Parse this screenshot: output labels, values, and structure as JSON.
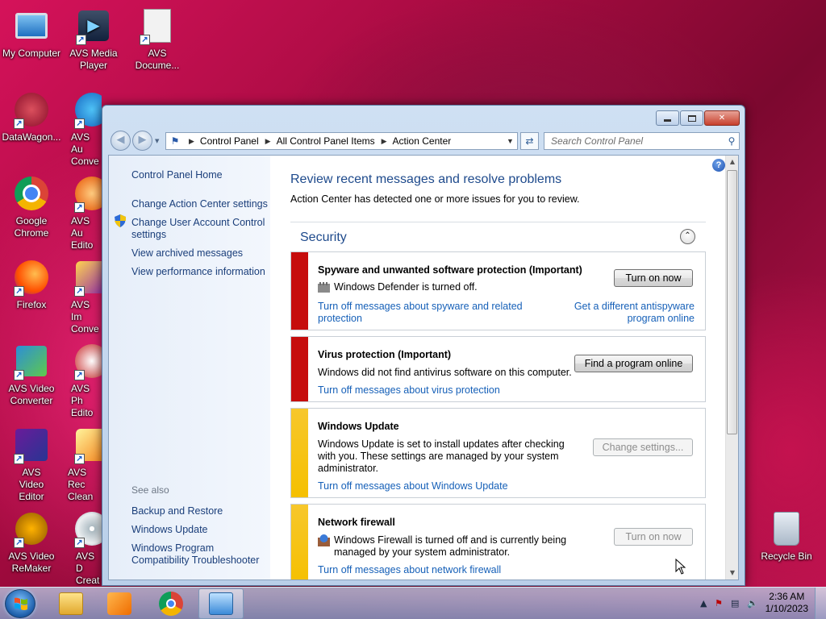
{
  "desktop": {
    "icons": [
      {
        "label": "My Computer",
        "icon": "computer-icon"
      },
      {
        "label": "AVS Media Player",
        "icon": "media-player-icon"
      },
      {
        "label": "AVS Docume...",
        "icon": "document-converter-icon"
      },
      {
        "label": "DataWagon...",
        "icon": "datawagon-icon"
      },
      {
        "label": "AVS Au Conve",
        "icon": "audio-converter-icon"
      },
      {
        "label": "Google Chrome",
        "icon": "chrome-icon"
      },
      {
        "label": "AVS Au Edito",
        "icon": "audio-editor-icon"
      },
      {
        "label": "Firefox",
        "icon": "firefox-icon"
      },
      {
        "label": "AVS Im Conve",
        "icon": "image-converter-icon"
      },
      {
        "label": "AVS Video Converter",
        "icon": "video-converter-icon"
      },
      {
        "label": "AVS Ph Edito",
        "icon": "photo-editor-icon"
      },
      {
        "label": "AVS Video Editor",
        "icon": "video-editor-icon"
      },
      {
        "label": "AVS Rec Clean",
        "icon": "registry-cleaner-icon"
      },
      {
        "label": "AVS Video ReMaker",
        "icon": "video-remaker-icon"
      },
      {
        "label": "AVS D Creat",
        "icon": "disc-creator-icon"
      },
      {
        "label": "Recycle Bin",
        "icon": "recycle-bin-icon"
      }
    ]
  },
  "window": {
    "breadcrumb": [
      "Control Panel",
      "All Control Panel Items",
      "Action Center"
    ],
    "search_placeholder": "Search Control Panel",
    "controls": {
      "minimize": "minimize",
      "maximize": "maximize",
      "close": "close"
    }
  },
  "sidebar": {
    "home": "Control Panel Home",
    "links": [
      "Change Action Center settings",
      "Change User Account Control settings",
      "View archived messages",
      "View performance information"
    ],
    "see_also_label": "See also",
    "see_also": [
      "Backup and Restore",
      "Windows Update",
      "Windows Program Compatibility Troubleshooter"
    ]
  },
  "main": {
    "title": "Review recent messages and resolve problems",
    "subtitle": "Action Center has detected one or more issues for you to review.",
    "section": "Security",
    "cards": [
      {
        "title": "Spyware and unwanted software protection  (Important)",
        "text": "Windows Defender is turned off.",
        "link1": "Turn off messages about spyware and related protection",
        "link2": "Get a different antispyware program online",
        "button": "Turn on now",
        "severity": "important"
      },
      {
        "title": "Virus protection  (Important)",
        "text": "Windows did not find antivirus software on this computer.",
        "link1": "Turn off messages about virus protection",
        "button": "Find a program online",
        "severity": "important"
      },
      {
        "title": "Windows Update",
        "text": "Windows Update is set to install updates after checking with you.  These settings are managed by your system administrator.",
        "link1": "Turn off messages about Windows Update",
        "button": "Change settings...",
        "severity": "warning"
      },
      {
        "title": "Network firewall",
        "text": "Windows Firewall is turned off and is currently being managed by your system administrator.",
        "link1": "Turn off messages about network firewall",
        "button": "Turn on now",
        "severity": "warning"
      }
    ]
  },
  "taskbar": {
    "items": [
      "windows-explorer",
      "media-player",
      "chrome",
      "control-panel"
    ],
    "time": "2:36 AM",
    "date": "1/10/2023"
  },
  "colors": {
    "important": "#c60d0d",
    "warning": "#f5c000",
    "link": "#1660b8",
    "heading": "#1e4a8c"
  }
}
